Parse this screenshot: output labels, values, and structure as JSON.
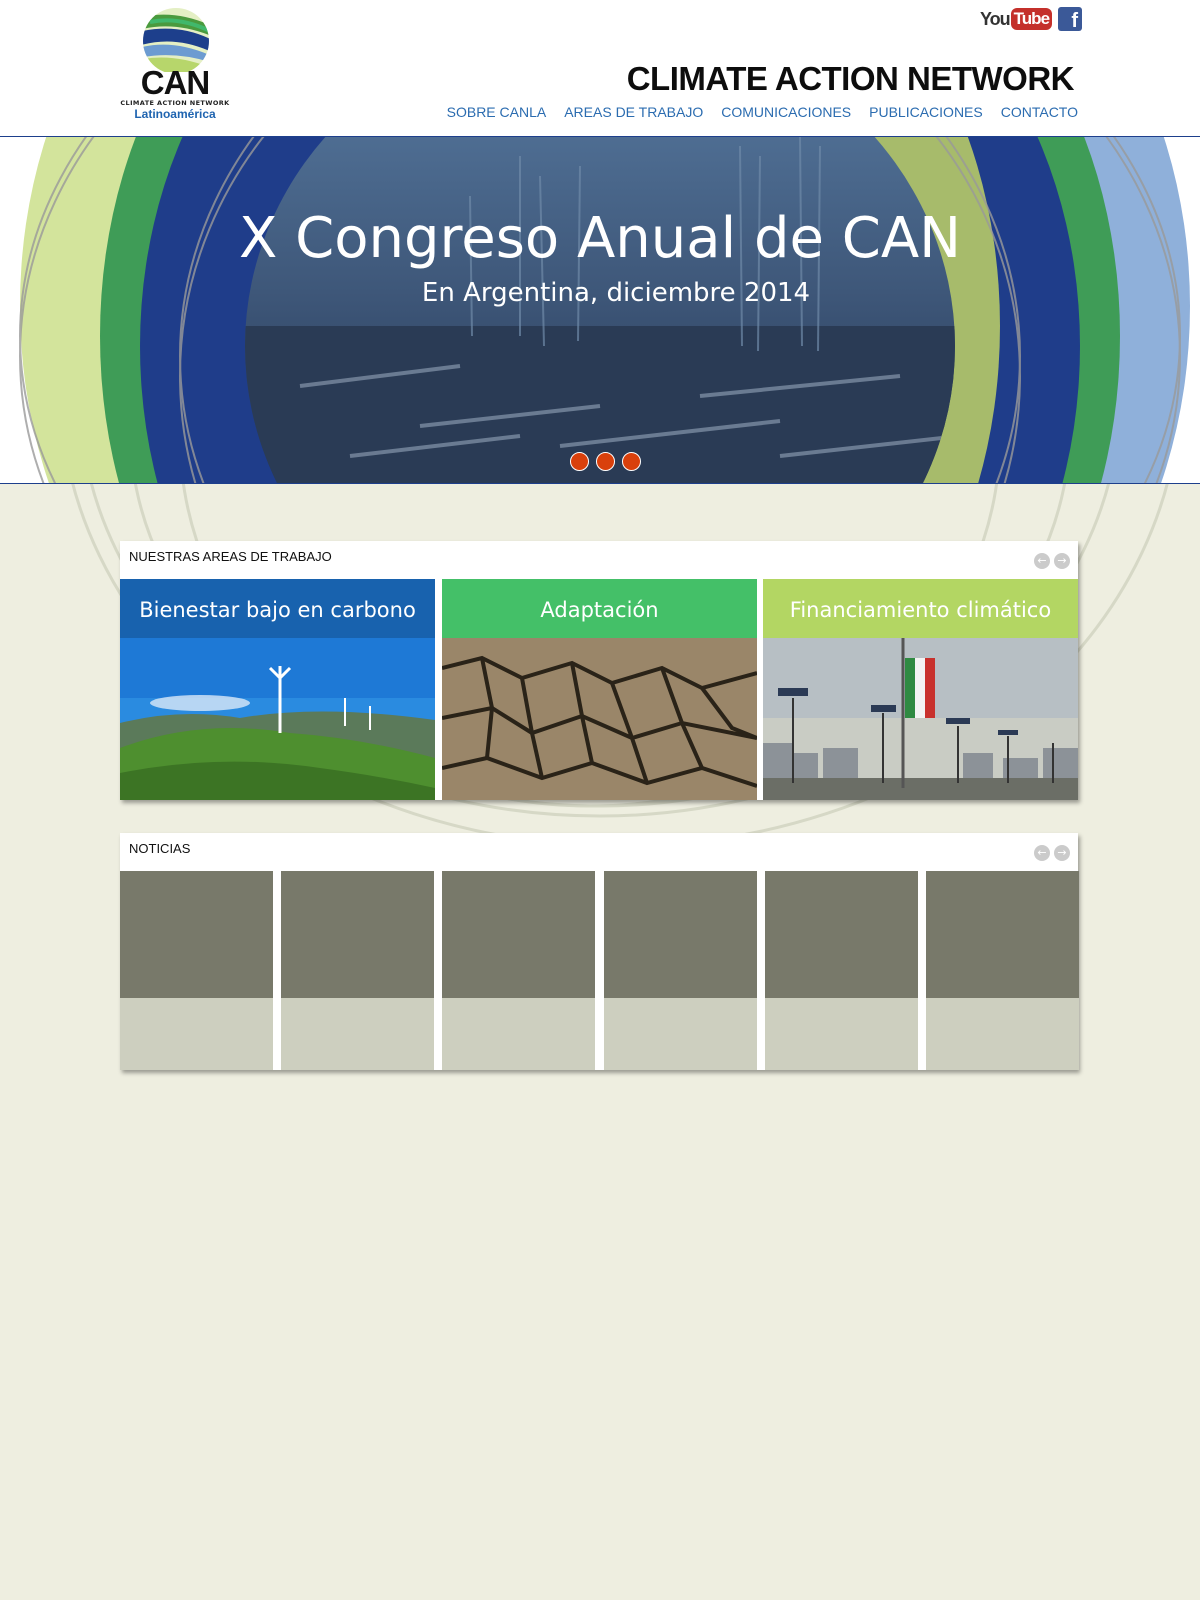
{
  "site": {
    "brand_title": "CLIMATE ACTION NETWORK",
    "logo": {
      "main": "CAN",
      "subtitle": "CLIMATE ACTION NETWORK",
      "region": "Latinoamérica"
    }
  },
  "social": {
    "youtube": {
      "you": "You",
      "tube": "Tube",
      "icon": "youtube-icon"
    },
    "facebook": {
      "letter": "f",
      "icon": "facebook-icon"
    }
  },
  "nav": {
    "items": [
      {
        "label": "SOBRE CANLA"
      },
      {
        "label": "AREAS DE TRABAJO"
      },
      {
        "label": "COMUNICACIONES"
      },
      {
        "label": "PUBLICACIONES"
      },
      {
        "label": "CONTACTO"
      }
    ]
  },
  "hero": {
    "title": "X Congreso Anual de CAN",
    "subtitle": "En Argentina, diciembre 2014",
    "slide_count": 3
  },
  "areas": {
    "title": "NUESTRAS AREAS DE TRABAJO",
    "prev_icon": "arrow-left-icon",
    "next_icon": "arrow-right-icon",
    "cards": [
      {
        "label": "Bienestar bajo en carbono",
        "color": "#1862ae",
        "image": "wind-turbines-hills"
      },
      {
        "label": "Adaptación",
        "color": "#44c068",
        "image": "cracked-dry-earth"
      },
      {
        "label": "Financiamiento climático",
        "color": "#b3d663",
        "image": "mexican-flag-city-street"
      }
    ]
  },
  "news": {
    "title": "NOTICIAS",
    "prev_icon": "arrow-left-icon",
    "next_icon": "arrow-right-icon",
    "card_count": 6
  },
  "colors": {
    "page_bg": "#eeeee0",
    "nav_text": "#2b6cb0",
    "hero_rule": "#1d3f8c",
    "slider_dot": "#d9400c",
    "news_image_placeholder": "#78796a",
    "news_text_placeholder": "#cdcfbf"
  }
}
